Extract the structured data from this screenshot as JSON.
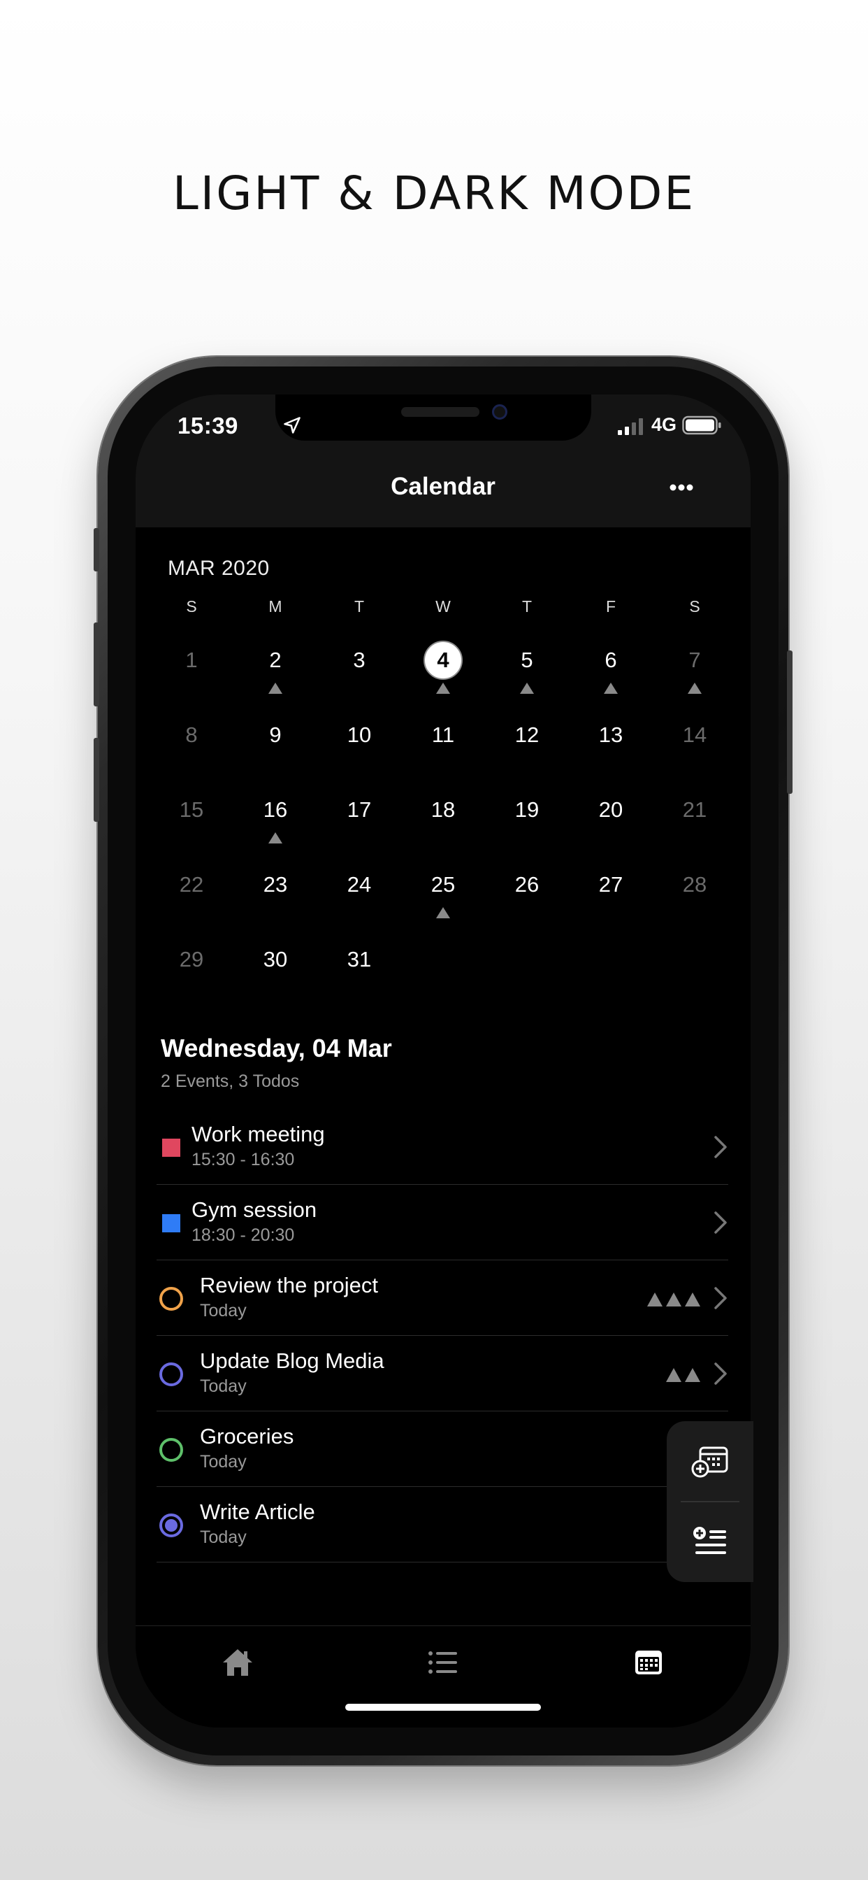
{
  "headline": "LIGHT & DARK MODE",
  "status_bar": {
    "time": "15:39",
    "network": "4G"
  },
  "nav": {
    "title": "Calendar"
  },
  "calendar": {
    "month_label": "MAR 2020",
    "weekdays": [
      "S",
      "M",
      "T",
      "W",
      "T",
      "F",
      "S"
    ],
    "weeks": [
      [
        {
          "d": "1",
          "muted": true
        },
        {
          "d": "2",
          "mark": true
        },
        {
          "d": "3"
        },
        {
          "d": "4",
          "today": true,
          "mark": true
        },
        {
          "d": "5",
          "mark": true
        },
        {
          "d": "6",
          "mark": true
        },
        {
          "d": "7",
          "muted": true,
          "mark": true
        }
      ],
      [
        {
          "d": "8",
          "muted": true
        },
        {
          "d": "9"
        },
        {
          "d": "10"
        },
        {
          "d": "11"
        },
        {
          "d": "12"
        },
        {
          "d": "13"
        },
        {
          "d": "14",
          "muted": true
        }
      ],
      [
        {
          "d": "15",
          "muted": true
        },
        {
          "d": "16",
          "mark": true
        },
        {
          "d": "17"
        },
        {
          "d": "18"
        },
        {
          "d": "19"
        },
        {
          "d": "20"
        },
        {
          "d": "21",
          "muted": true
        }
      ],
      [
        {
          "d": "22",
          "muted": true
        },
        {
          "d": "23"
        },
        {
          "d": "24"
        },
        {
          "d": "25",
          "mark": true
        },
        {
          "d": "26"
        },
        {
          "d": "27"
        },
        {
          "d": "28",
          "muted": true
        }
      ],
      [
        {
          "d": "29",
          "muted": true
        },
        {
          "d": "30"
        },
        {
          "d": "31"
        }
      ]
    ]
  },
  "agenda": {
    "day_title": "Wednesday, 04 Mar",
    "summary": "2 Events, 3 Todos",
    "items": [
      {
        "kind": "event",
        "title": "Work meeting",
        "sub": "15:30 - 16:30",
        "color": "#e0475f",
        "priority": 0,
        "chevron": true
      },
      {
        "kind": "event",
        "title": "Gym session",
        "sub": "18:30 - 20:30",
        "color": "#2f7cf6",
        "priority": 0,
        "chevron": true
      },
      {
        "kind": "todo",
        "title": "Review the project",
        "sub": "Today",
        "color": "#f0a24a",
        "priority": 3,
        "chevron": true,
        "done": false
      },
      {
        "kind": "todo",
        "title": "Update Blog Media",
        "sub": "Today",
        "color": "#6a6ae0",
        "priority": 2,
        "chevron": true,
        "done": false
      },
      {
        "kind": "todo",
        "title": "Groceries",
        "sub": "Today",
        "color": "#5ec06a",
        "priority": 0,
        "chevron": false,
        "done": false
      },
      {
        "kind": "todo",
        "title": "Write Article",
        "sub": "Today",
        "color": "#6a6ae0",
        "priority": 0,
        "chevron": false,
        "done": true
      }
    ]
  },
  "icons": {
    "fab": [
      "add-event-icon",
      "add-todo-icon"
    ],
    "tabs": [
      "home-icon",
      "list-icon",
      "calendar-icon"
    ]
  }
}
